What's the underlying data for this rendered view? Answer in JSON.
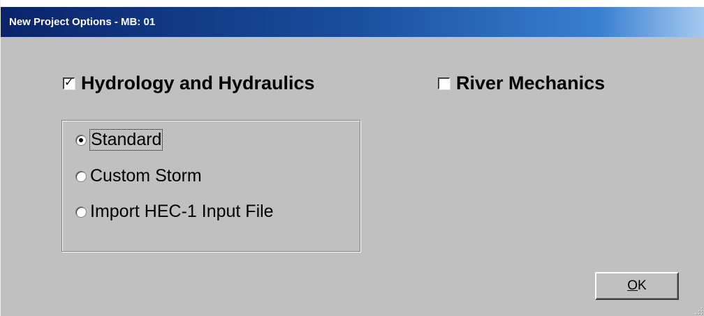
{
  "window": {
    "title": "New Project Options - MB: 01"
  },
  "options": {
    "hydrology": {
      "label": "Hydrology and Hydraulics",
      "checked": true
    },
    "river": {
      "label": "River Mechanics",
      "checked": false
    }
  },
  "radios": [
    {
      "label": "Standard",
      "selected": true
    },
    {
      "label": "Custom Storm",
      "selected": false
    },
    {
      "label": "Import HEC-1 Input File",
      "selected": false
    }
  ],
  "buttons": {
    "ok_mnemonic": "O",
    "ok_rest": "K"
  },
  "icons": {
    "check": "check-mark-icon",
    "radio_dot": "radio-dot-icon",
    "grip": "resize-grip-icon"
  }
}
